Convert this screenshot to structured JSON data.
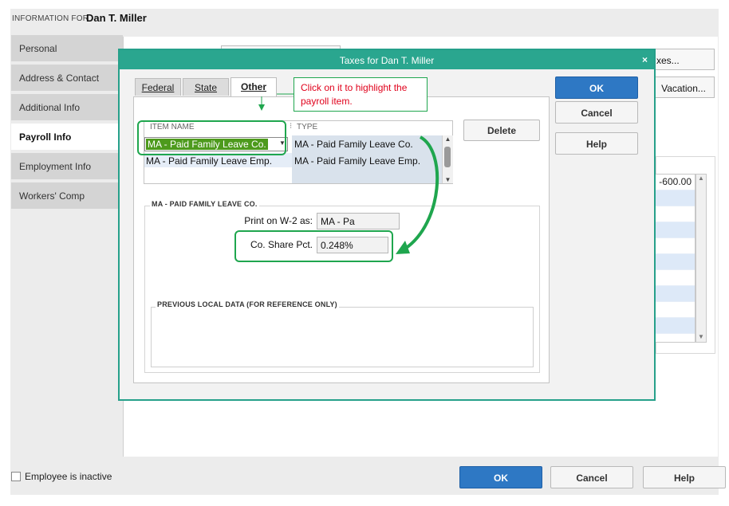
{
  "window": {
    "info_label": "INFORMATION FOR",
    "employee_name": "Dan T. Miller",
    "nav": [
      {
        "label": "Personal",
        "active": false
      },
      {
        "label": "Address & Contact",
        "active": false
      },
      {
        "label": "Additional Info",
        "active": false
      },
      {
        "label": "Payroll Info",
        "active": true
      },
      {
        "label": "Employment Info",
        "active": false
      },
      {
        "label": "Workers' Comp",
        "active": false
      }
    ],
    "bg_buttons": {
      "taxes": "xes...",
      "vacation": "Vacation..."
    },
    "bg_value": "-600.00",
    "inactive_label": "Employee is inactive",
    "ok": "OK",
    "cancel": "Cancel",
    "help": "Help"
  },
  "dialog": {
    "title": "Taxes for Dan T. Miller",
    "close": "×",
    "tabs": [
      {
        "label": "Federal",
        "active": false
      },
      {
        "label": "State",
        "active": false
      },
      {
        "label": "Other",
        "active": true
      }
    ],
    "table": {
      "col_item": "ITEM NAME",
      "col_type": "TYPE",
      "rows": [
        {
          "item": "MA - Paid Family Leave Co.",
          "type": "MA - Paid Family Leave Co."
        },
        {
          "item": "MA - Paid Family Leave Emp.",
          "type": "MA - Paid Family Leave Emp."
        }
      ]
    },
    "delete": "Delete",
    "section_title": "MA - PAID FAMILY LEAVE CO.",
    "print_w2_label": "Print on W-2 as:",
    "print_w2_value": "MA - Pa",
    "share_label": "Co. Share Pct.",
    "share_value": "0.248%",
    "prev_title": "PREVIOUS LOCAL DATA (FOR REFERENCE ONLY)",
    "ok": "OK",
    "cancel": "Cancel",
    "help": "Help"
  },
  "annotation": {
    "callout_text": "Click on it to highlight the payroll item.",
    "color": "#1fa64e",
    "text_color": "#e0001b"
  },
  "colors": {
    "dialog_title_bg": "#2aa68f",
    "primary_button": "#2e78c4",
    "selection": "#4d9a1c"
  }
}
